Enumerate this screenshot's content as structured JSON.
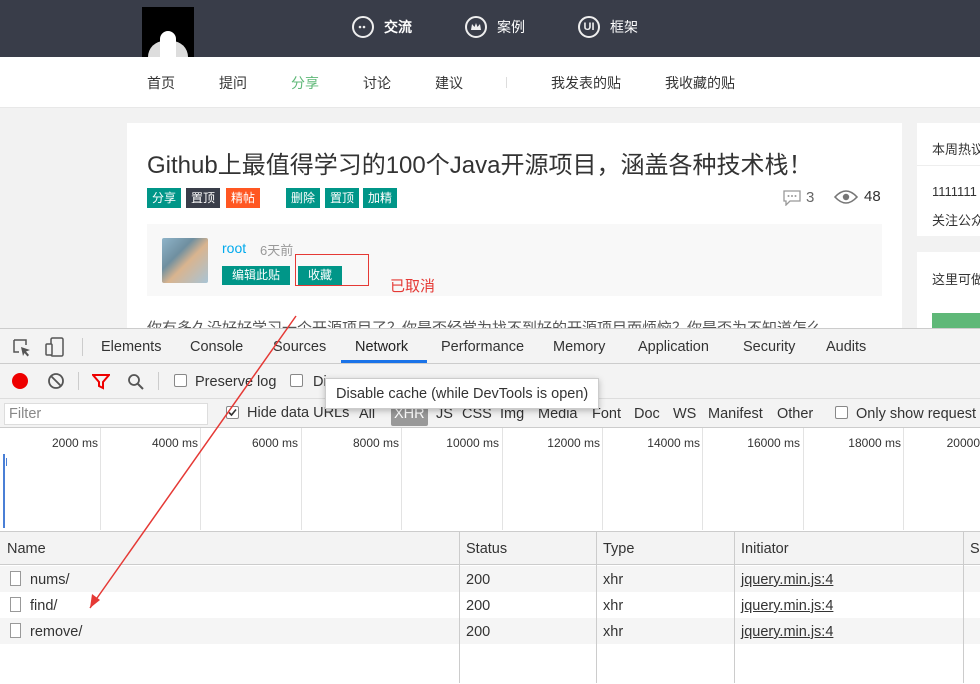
{
  "topnav": {
    "items": [
      {
        "label": "交流",
        "icon": "chat-icon"
      },
      {
        "label": "案例",
        "icon": "crown-icon"
      },
      {
        "label": "框架",
        "icon": "ui-icon",
        "glyph": "UI"
      }
    ]
  },
  "subnav": {
    "items": [
      "首页",
      "提问",
      "分享",
      "讨论",
      "建议",
      "我发表的贴",
      "我收藏的贴"
    ],
    "active": "分享"
  },
  "article": {
    "title": "Github上最值得学习的100个Java开源项目，涵盖各种技术栈！",
    "tags": [
      {
        "label": "分享",
        "color": "#009688"
      },
      {
        "label": "置顶",
        "color": "#393d49"
      },
      {
        "label": "精帖",
        "color": "#ff5722"
      },
      {
        "label": "删除",
        "color": "#009688"
      },
      {
        "label": "置顶",
        "color": "#009688"
      },
      {
        "label": "加精",
        "color": "#009688"
      }
    ],
    "comments": "3",
    "views": "48",
    "author": "root",
    "time": "6天前",
    "edit_button": "编辑此贴",
    "collect_button": "收藏",
    "annotation": "已取消",
    "body_preview": "你有多久没好好学习一个开源项目了？你是否经常为找不到好的开源项目而烦恼？你是否为不知道怎么"
  },
  "sidebar": {
    "card1_title": "本周热议",
    "card1_line1": "1111111",
    "card1_line2": "关注公众",
    "card2_title": "这里可做"
  },
  "devtools": {
    "tabs": [
      "Elements",
      "Console",
      "Sources",
      "Network",
      "Performance",
      "Memory",
      "Application",
      "Security",
      "Audits"
    ],
    "active_tab": "Network",
    "preserve_log": "Preserve log",
    "disable_cache_partial": "Di",
    "tooltip": "Disable cache (while DevTools is open)",
    "filter_placeholder": "Filter",
    "hide_data_urls": "Hide data URLs",
    "types": [
      "All",
      "XHR",
      "JS",
      "CSS",
      "Img",
      "Media",
      "Font",
      "Doc",
      "WS",
      "Manifest",
      "Other"
    ],
    "active_type": "XHR",
    "only_show": "Only show request",
    "timeline_ticks": [
      "2000 ms",
      "4000 ms",
      "6000 ms",
      "8000 ms",
      "10000 ms",
      "12000 ms",
      "14000 ms",
      "16000 ms",
      "18000 ms",
      "20000"
    ],
    "columns": [
      "Name",
      "Status",
      "Type",
      "Initiator",
      "Si"
    ],
    "rows": [
      {
        "name": "nums/",
        "status": "200",
        "type": "xhr",
        "initiator": "jquery.min.js:4"
      },
      {
        "name": "find/",
        "status": "200",
        "type": "xhr",
        "initiator": "jquery.min.js:4"
      },
      {
        "name": "remove/",
        "status": "200",
        "type": "xhr",
        "initiator": "jquery.min.js:4"
      }
    ]
  }
}
